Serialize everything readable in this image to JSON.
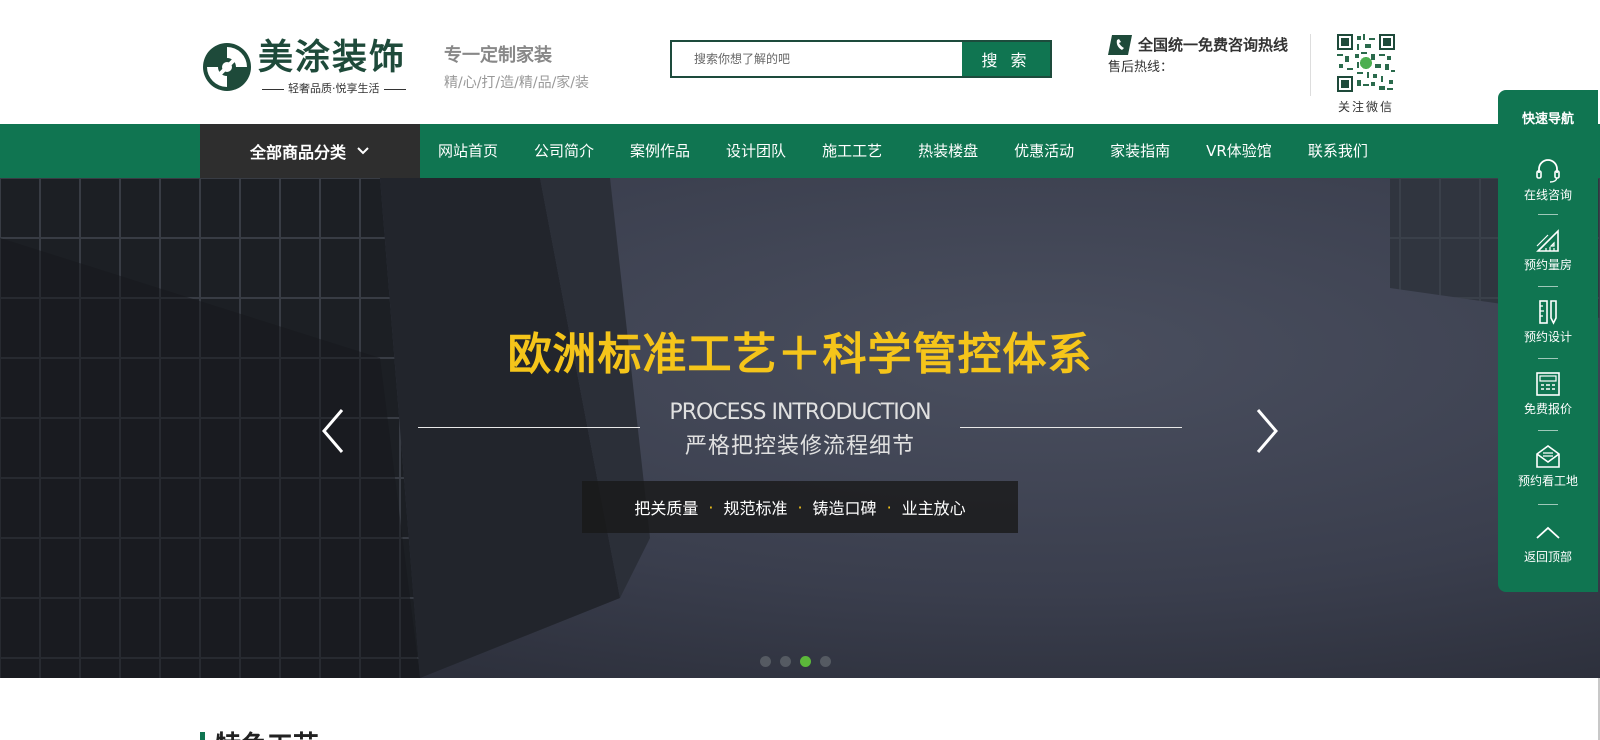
{
  "header": {
    "logo_name": "美涂装饰",
    "logo_tagline": "轻奢品质·悦享生活",
    "slogan_main": "专一定制家装",
    "slogan_sub": "精/心/打/造/精/品/家/装",
    "search": {
      "placeholder": "搜索你想了解的吧",
      "button": "搜 索"
    },
    "hotline_label": "全国统一免费咨询热线",
    "aftersale_label": "售后热线：",
    "qr_label": "关注微信"
  },
  "nav": {
    "category_button": "全部商品分类",
    "items": [
      "网站首页",
      "公司简介",
      "案例作品",
      "设计团队",
      "施工工艺",
      "热装楼盘",
      "优惠活动",
      "家装指南",
      "VR体验馆",
      "联系我们"
    ]
  },
  "banner": {
    "title": "欧洲标准工艺＋科学管控体系",
    "subtitle_en": "PROCESS INTRODUCTION",
    "subtitle_cn": "严格把控装修流程细节",
    "tags": [
      "把关质量",
      "规范标准",
      "铸造口碑",
      "业主放心"
    ],
    "separator": "·",
    "active_slide": 3,
    "slide_count": 4
  },
  "section": {
    "title": "特色工艺"
  },
  "float_nav": {
    "title": "快速导航",
    "items": [
      {
        "label": "在线咨询",
        "icon": "headset-icon"
      },
      {
        "label": "预约量房",
        "icon": "ruler-triangle-icon"
      },
      {
        "label": "预约设计",
        "icon": "pencil-ruler-icon"
      },
      {
        "label": "免费报价",
        "icon": "calculator-icon"
      },
      {
        "label": "预约看工地",
        "icon": "envelope-icon"
      },
      {
        "label": "返回顶部",
        "icon": "chevron-up-icon"
      }
    ]
  },
  "colors": {
    "brand_green": "#107551",
    "dark_green": "#1e4a3a",
    "category_bg": "#2e2e2e",
    "banner_title": "#f5c51a",
    "active_dot": "#5cb83a"
  }
}
